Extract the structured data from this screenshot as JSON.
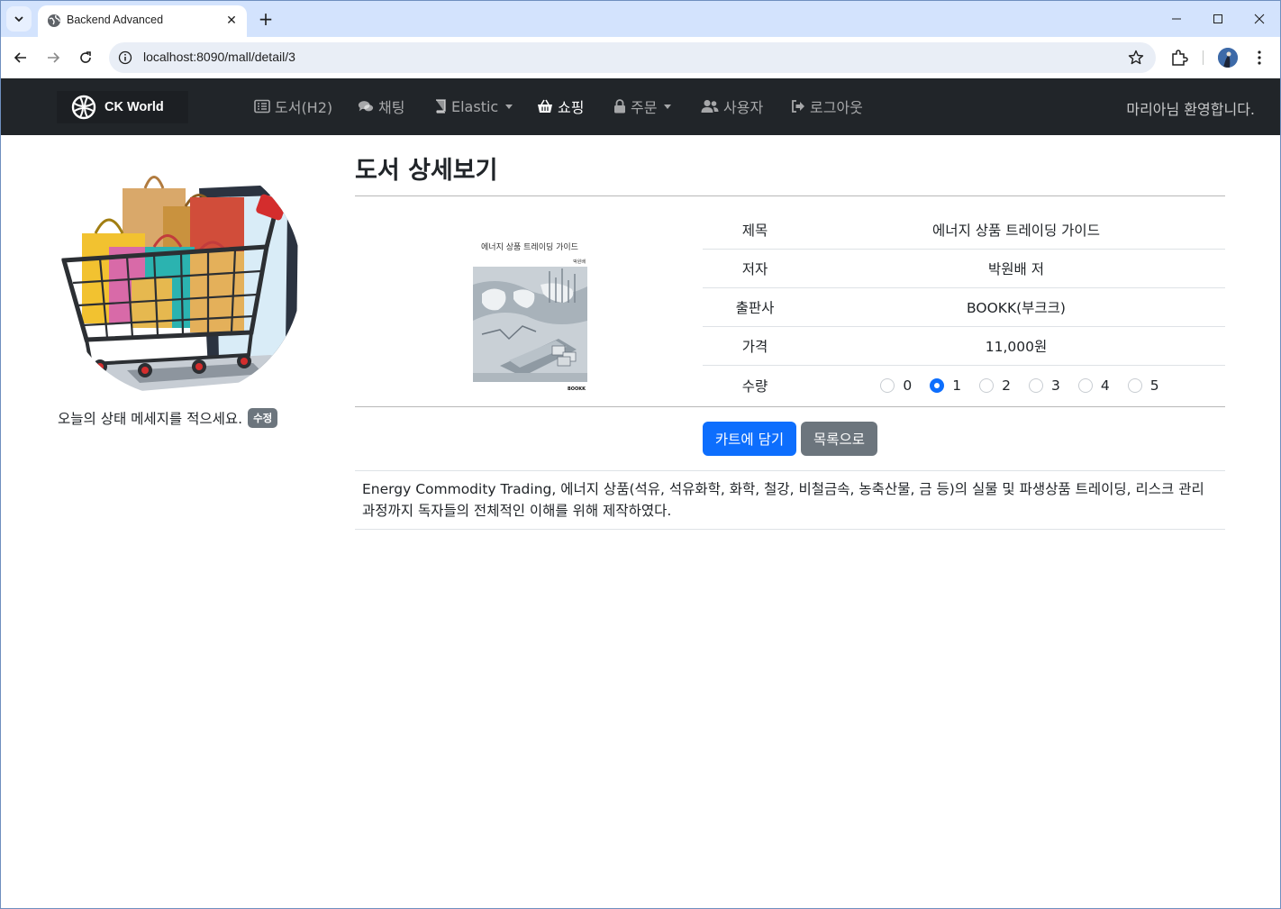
{
  "browser": {
    "tab_title": "Backend Advanced",
    "url": "localhost:8090/mall/detail/3"
  },
  "navbar": {
    "brand": "CK World",
    "items": [
      {
        "label": "도서(H2)",
        "icon": "list-icon"
      },
      {
        "label": "채팅",
        "icon": "comments-icon"
      },
      {
        "label": "Elastic",
        "icon": "book-icon",
        "dropdown": true
      },
      {
        "label": "쇼핑",
        "icon": "basket-icon",
        "active": true
      },
      {
        "label": "주문",
        "icon": "lock-icon",
        "dropdown": true
      },
      {
        "label": "사용자",
        "icon": "users-icon"
      },
      {
        "label": "로그아웃",
        "icon": "sign-out-icon"
      }
    ],
    "welcome": "마리아님 환영합니다."
  },
  "sidebar": {
    "status_message": "오늘의 상태 메세지를 적으세요.",
    "edit_label": "수정"
  },
  "page": {
    "title": "도서 상세보기"
  },
  "book": {
    "cover_title": "에너지 상품 트레이딩 가이드",
    "cover_author": "박원배",
    "cover_publisher": "BOOKK",
    "rows": [
      {
        "label": "제목",
        "value": "에너지 상품 트레이딩 가이드"
      },
      {
        "label": "저자",
        "value": "박원배 저"
      },
      {
        "label": "출판사",
        "value": "BOOKK(부크크)"
      },
      {
        "label": "가격",
        "value": "11,000원"
      }
    ],
    "quantity_label": "수량",
    "quantity_options": [
      "0",
      "1",
      "2",
      "3",
      "4",
      "5"
    ],
    "quantity_selected": "1",
    "description": "Energy Commodity Trading, 에너지 상품(석유, 석유화학, 화학, 철강, 비철금속, 농축산물, 금 등)의 실물 및 파생상품 트레이딩, 리스크 관리 과정까지 독자들의 전체적인 이해를 위해 제작하였다."
  },
  "actions": {
    "add_to_cart": "카트에 담기",
    "back_to_list": "목록으로"
  },
  "colors": {
    "navbar_bg": "#212529",
    "primary": "#0d6efd",
    "secondary": "#6c757d",
    "chrome_tabstrip": "#d3e3fd"
  }
}
